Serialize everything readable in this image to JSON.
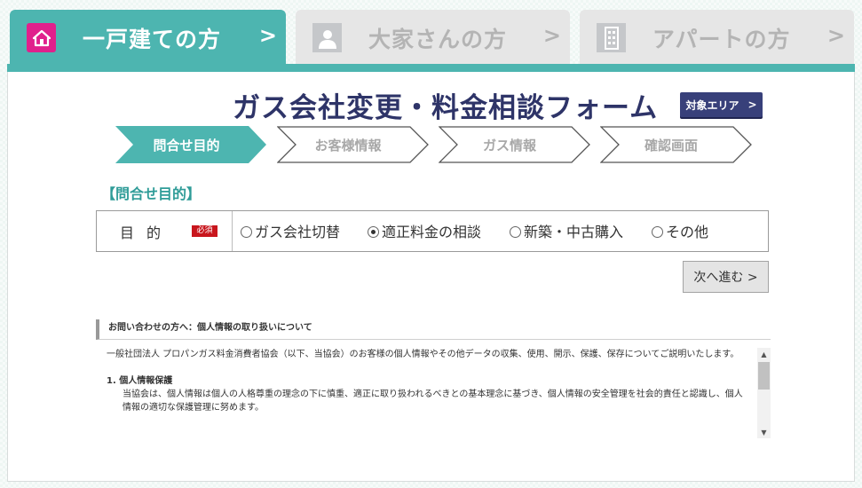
{
  "tabs": [
    {
      "label": "一戸建ての方",
      "icon": "house-icon",
      "active": true
    },
    {
      "label": "大家さんの方",
      "icon": "person-icon",
      "active": false
    },
    {
      "label": "アパートの方",
      "icon": "building-icon",
      "active": false
    }
  ],
  "tab_chevron": ">",
  "page_title": "ガス会社変更・料金相談フォーム",
  "area_button": {
    "label": "対象エリア",
    "chevron": ">"
  },
  "steps": [
    "問合せ目的",
    "お客様情報",
    "ガス情報",
    "確認画面"
  ],
  "section_heading": "【問合せ目的】",
  "purpose": {
    "label": "目的",
    "required_badge": "必須",
    "options": [
      "ガス会社切替",
      "適正料金の相談",
      "新築・中古購入",
      "その他"
    ],
    "selected_index": 1
  },
  "next_button": "次へ進む >",
  "privacy": {
    "heading": "お問い合わせの方へ：個人情報の取り扱いについて",
    "intro": "一般社団法人 プロパンガス料金消費者協会（以下、当協会）のお客様の個人情報やその他データの収集、使用、開示、保護、保存についてご説明いたします。",
    "item1_title": "1. 個人情報保護",
    "item1_body": "当協会は、個人情報は個人の人格尊重の理念の下に慎重、適正に取り扱われるべきとの基本理念に基づき、個人情報の安全管理を社会的責任と認識し、個人情報の適切な保護管理に努めます。"
  },
  "colors": {
    "accent": "#4db5b0",
    "title": "#2e3468",
    "pink": "#e0208c",
    "required": "#c8161d"
  }
}
